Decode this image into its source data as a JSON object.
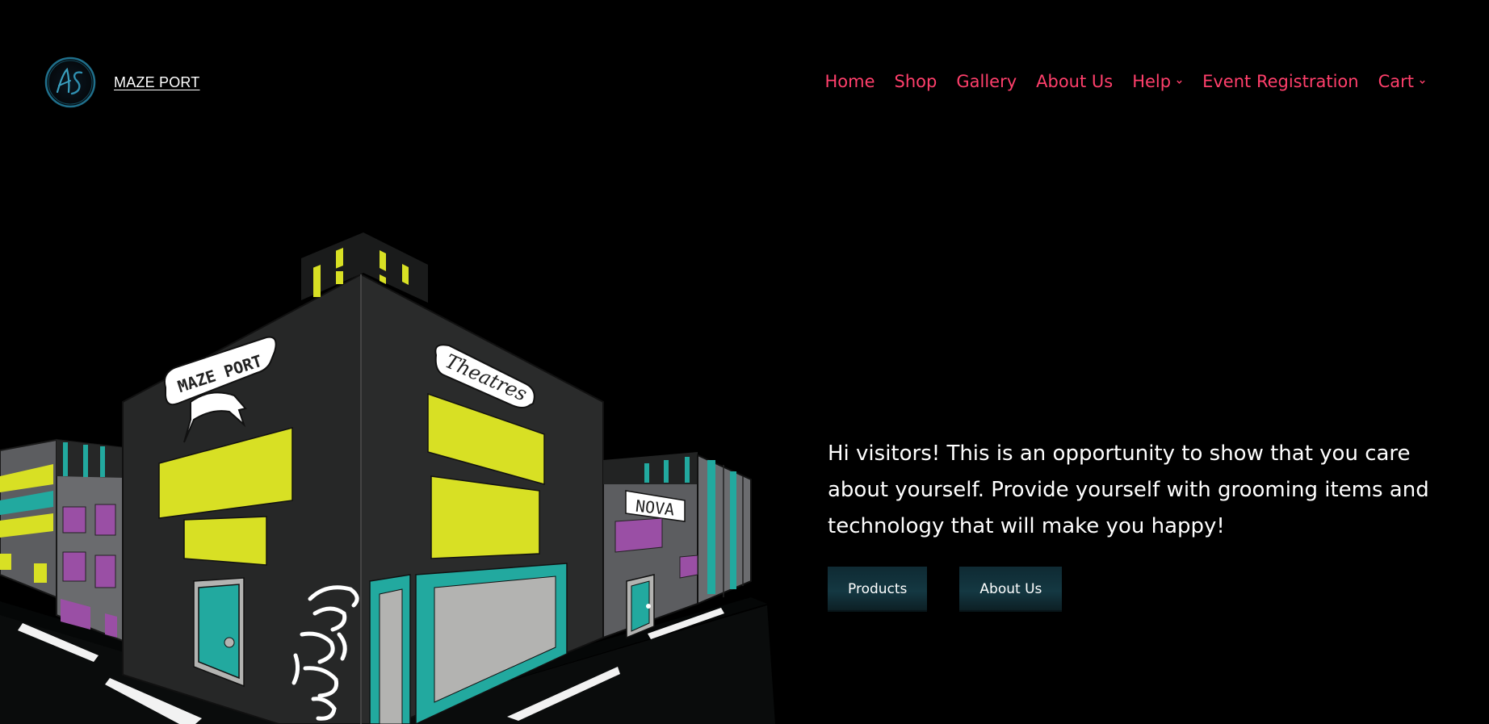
{
  "header": {
    "site_title": "MAZE PORT",
    "logo_initials": "AS",
    "nav": [
      {
        "label": "Home",
        "has_dropdown": false
      },
      {
        "label": "Shop",
        "has_dropdown": false
      },
      {
        "label": "Gallery",
        "has_dropdown": false
      },
      {
        "label": "About Us",
        "has_dropdown": false
      },
      {
        "label": "Help",
        "has_dropdown": true
      },
      {
        "label": "Event Registration",
        "has_dropdown": false
      },
      {
        "label": "Cart",
        "has_dropdown": true
      }
    ]
  },
  "illustration": {
    "signs": {
      "main": "MAZE PORT",
      "theatre": "Theatres",
      "shop": "NOVA"
    }
  },
  "hero": {
    "text": "Hi visitors! This is an opportunity to show that you care about yourself. Provide yourself with grooming items and technology that will make you happy!",
    "buttons": {
      "products": "Products",
      "about": "About Us"
    }
  },
  "colors": {
    "background": "#000000",
    "nav_link": "#ff3f6b",
    "button_bg": "#143842",
    "building_yellow": "#d8e024",
    "building_teal": "#22a99f",
    "building_purple": "#9a4fa5"
  }
}
